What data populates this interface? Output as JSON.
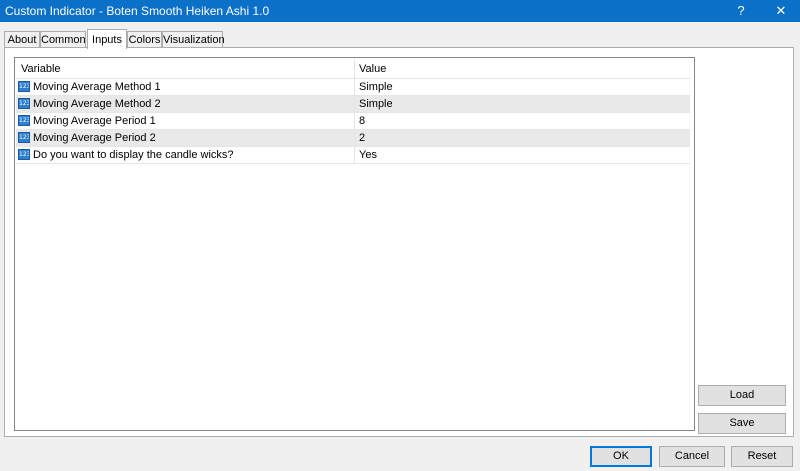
{
  "window": {
    "title": "Custom Indicator - Boten Smooth Heiken Ashi 1.0",
    "help_glyph": "?",
    "close_glyph": "✕"
  },
  "tabs": [
    {
      "label": "About"
    },
    {
      "label": "Common"
    },
    {
      "label": "Inputs",
      "active": true
    },
    {
      "label": "Colors"
    },
    {
      "label": "Visualization"
    }
  ],
  "table": {
    "columns": [
      "Variable",
      "Value"
    ],
    "rows": [
      {
        "variable": "Moving Average Method 1",
        "value": "Simple",
        "icon": "123-icon"
      },
      {
        "variable": "Moving Average Method 2",
        "value": "Simple",
        "icon": "123-icon"
      },
      {
        "variable": "Moving Average Period 1",
        "value": "8",
        "icon": "123-icon"
      },
      {
        "variable": "Moving Average Period 2",
        "value": "2",
        "icon": "123-icon"
      },
      {
        "variable": "Do you want to display the candle wicks?",
        "value": "Yes",
        "icon": "123-icon"
      }
    ],
    "icon_text": "123"
  },
  "buttons": {
    "load": "Load",
    "save": "Save",
    "ok": "OK",
    "cancel": "Cancel",
    "reset": "Reset"
  },
  "colors": {
    "titlebar": "#0a70c8",
    "row_alt": "#e9e9e9",
    "default_button_border": "#0078d7"
  }
}
